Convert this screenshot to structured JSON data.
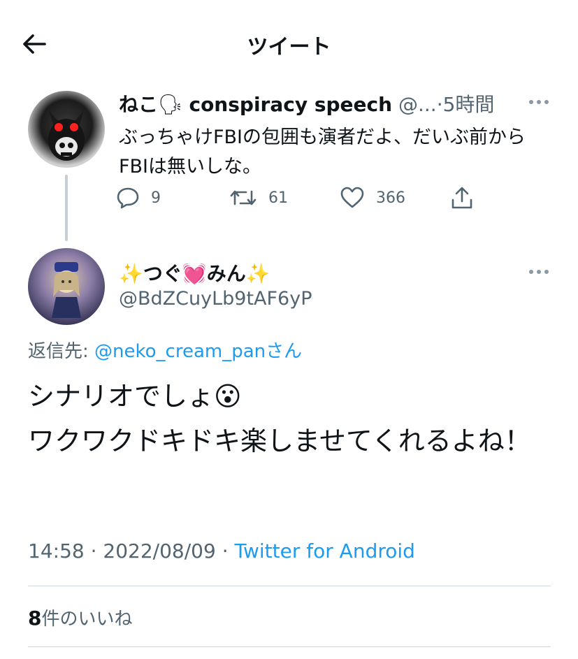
{
  "header": {
    "title": "ツイート",
    "back_icon": "arrow-left-icon"
  },
  "parent_tweet": {
    "name": "ねこ",
    "name_emoji": "🗣",
    "name_suffix": "conspiracy speech",
    "handle_truncated": "@...",
    "separator": "·",
    "time": "5時間",
    "text": "ぶっちゃけFBIの包囲も演者だよ、だいぶ前からFBIは無いしな。",
    "actions": {
      "reply_count": "9",
      "retweet_count": "61",
      "like_count": "366"
    }
  },
  "reply_tweet": {
    "name_prefix": "✨",
    "name_part1": "つぐ",
    "name_heart": "💓",
    "name_part2": "みん",
    "name_suffix": "✨",
    "handle": "@BdZCuyLb9tAF6yP",
    "reply_to_label": "返信先:",
    "reply_to_handle": "@neko_cream_pan",
    "reply_to_suffix": "さん",
    "line1": "シナリオでしょ",
    "line1_emoji": "😮",
    "line2": "ワクワクドキドキ楽しませてくれるよね！",
    "time": "14:58",
    "dot": "·",
    "date": "2022/08/09",
    "dot2": "·",
    "source": "Twitter for Android",
    "likes_count": "8",
    "likes_label": "件のいいね"
  },
  "colors": {
    "accent": "#1d9bf0",
    "muted": "#536471",
    "text": "#0f1419"
  }
}
